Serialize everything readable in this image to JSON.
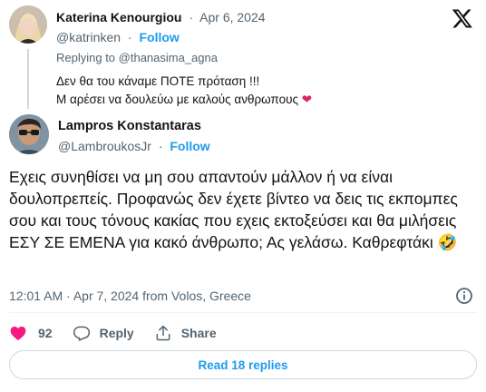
{
  "parent_tweet": {
    "author_name": "Katerina Kenourgiou",
    "date": "Apr 6, 2024",
    "handle": "@katrinken",
    "follow_label": "Follow",
    "replying_prefix": "Replying to ",
    "replying_to": "@thanasima_agna",
    "text_line1": "Δεν θα του κάναμε ΠΟΤΕ πρόταση !!!",
    "text_line2": "Μ αρέσει να δουλεύω με καλούς ανθρωπους",
    "text_emoji": "❤"
  },
  "tweet": {
    "author_name": "Lampros Konstantaras",
    "handle": "@LambroukosJr",
    "follow_label": "Follow",
    "text": "Εχεις συνηθίσει να μη σου απαντούν μάλλον ή να είναι δουλοπρεπείς. Προφανώς δεν έχετε βίντεο να δεις τις εκπομπες σου και τους τόνους κακίας που εχεις εκτοξεύσει και θα μιλήσεις ΕΣΥ ΣΕ ΕΜΕΝΑ για κακό άνθρωπο; Ας γελάσω. Καθρεφτάκι",
    "text_emoji": "🤣",
    "timestamp": "12:01 AM · Apr 7, 2024 from Volos, Greece",
    "likes_count": "92",
    "reply_label": "Reply",
    "share_label": "Share",
    "read_replies_label": "Read 18 replies"
  },
  "icons": {
    "brand": "x-logo-icon",
    "like": "heart-icon",
    "reply": "speech-bubble-icon",
    "share": "share-upload-icon",
    "info": "info-icon"
  },
  "colors": {
    "accent": "#1d9bf0",
    "like": "#f91880",
    "text": "#0f1419",
    "muted": "#536471"
  }
}
